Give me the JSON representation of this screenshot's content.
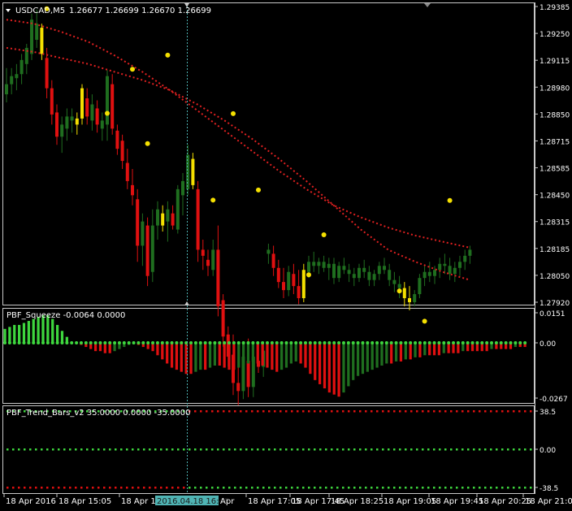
{
  "main_panel": {
    "symbol_title": "USDCAD,M5",
    "ohlc_values": "1.26677 1.26699 1.26670 1.26699",
    "price_axis_labels": [
      "1.29385",
      "1.29250",
      "1.29115",
      "1.28980",
      "1.28850",
      "1.28715",
      "1.28585",
      "1.28450",
      "1.28315",
      "1.28185",
      "1.28050",
      "1.27920"
    ],
    "colors": {
      "bull": "#1f6e1f",
      "bear": "#e01010",
      "squeeze": "#f5e000",
      "ma": "#e02020",
      "dot": "#f5e000"
    }
  },
  "indicator_squeeze": {
    "label": "PBF_Squeeze -0.0064 0.0000",
    "axis_labels": [
      "0.0151",
      "0.00",
      "-0.0267"
    ]
  },
  "indicator_trend_bars": {
    "label": "PBF_Trend_Bars_v2 35.0000 0.0000 -35.0000",
    "axis_labels": [
      "38.5",
      "0.00",
      "-38.5"
    ]
  },
  "time_axis": {
    "labels": [
      "18 Apr 2016",
      "18 Apr 15:05",
      "18 Apr 15:45",
      "18 Apr 17:05",
      "18 Apr 17:45",
      "18 Apr 18:25",
      "18 Apr 19:05",
      "18 Apr 19:45",
      "18 Apr 20:25",
      "18 Apr 21:05"
    ],
    "crosshair_label": "2016.04.18 16:45",
    "partial_label": "Apr"
  },
  "chart_data": {
    "type": "candlestick",
    "title": "USDCAD,M5",
    "ylim": [
      1.2792,
      1.29385
    ],
    "candles": [
      [
        1.2895,
        1.2908,
        1.2891,
        1.29,
        "bull"
      ],
      [
        1.29,
        1.2908,
        1.2895,
        1.2904,
        "bull"
      ],
      [
        1.2903,
        1.291,
        1.2897,
        1.2905,
        "bull"
      ],
      [
        1.2905,
        1.2915,
        1.29,
        1.2912,
        "bull"
      ],
      [
        1.291,
        1.292,
        1.2905,
        1.2918,
        "bull"
      ],
      [
        1.2915,
        1.2935,
        1.2912,
        1.2932,
        "bull"
      ],
      [
        1.293,
        1.2937,
        1.2918,
        1.2922,
        "bull"
      ],
      [
        1.2928,
        1.293,
        1.2912,
        1.2915,
        "squeeze"
      ],
      [
        1.2913,
        1.2918,
        1.2893,
        1.2898,
        "bear"
      ],
      [
        1.2898,
        1.2902,
        1.288,
        1.2885,
        "bear"
      ],
      [
        1.2886,
        1.289,
        1.287,
        1.2874,
        "bear"
      ],
      [
        1.2874,
        1.2884,
        1.2866,
        1.288,
        "bull"
      ],
      [
        1.2878,
        1.2888,
        1.2872,
        1.2884,
        "bull"
      ],
      [
        1.2882,
        1.2888,
        1.2876,
        1.2884,
        "bull"
      ],
      [
        1.288,
        1.2886,
        1.2875,
        1.2883,
        "squeeze"
      ],
      [
        1.2883,
        1.29,
        1.288,
        1.2898,
        "squeeze"
      ],
      [
        1.2893,
        1.2898,
        1.288,
        1.2884,
        "bear"
      ],
      [
        1.2882,
        1.2895,
        1.2877,
        1.289,
        "bull"
      ],
      [
        1.2888,
        1.2892,
        1.2876,
        1.288,
        "bear"
      ],
      [
        1.2878,
        1.2886,
        1.2872,
        1.2882,
        "bull"
      ],
      [
        1.288,
        1.2907,
        1.2872,
        1.2904,
        "bull"
      ],
      [
        1.29,
        1.2905,
        1.2875,
        1.2878,
        "bear"
      ],
      [
        1.2877,
        1.288,
        1.2865,
        1.2868,
        "bear"
      ],
      [
        1.2872,
        1.2875,
        1.2858,
        1.2862,
        "bear"
      ],
      [
        1.2861,
        1.2868,
        1.2848,
        1.2852,
        "bear"
      ],
      [
        1.285,
        1.2858,
        1.284,
        1.2845,
        "bear"
      ],
      [
        1.2843,
        1.2848,
        1.2812,
        1.282,
        "bear"
      ],
      [
        1.282,
        1.2836,
        1.281,
        1.2832,
        "bull"
      ],
      [
        1.283,
        1.2834,
        1.28,
        1.2805,
        "bear"
      ],
      [
        1.2807,
        1.2838,
        1.2802,
        1.283,
        "bull"
      ],
      [
        1.283,
        1.2842,
        1.2823,
        1.2838,
        "bull"
      ],
      [
        1.2836,
        1.284,
        1.2827,
        1.283,
        "squeeze"
      ],
      [
        1.2832,
        1.2842,
        1.2822,
        1.2838,
        "bull"
      ],
      [
        1.2836,
        1.284,
        1.2828,
        1.283,
        "bear"
      ],
      [
        1.2828,
        1.285,
        1.2826,
        1.2848,
        "bull"
      ],
      [
        1.2845,
        1.2856,
        1.2835,
        1.2852,
        "bull"
      ],
      [
        1.2848,
        1.287,
        1.2845,
        1.2865,
        "bull"
      ],
      [
        1.2863,
        1.2866,
        1.2848,
        1.285,
        "squeeze"
      ],
      [
        1.2848,
        1.2852,
        1.2812,
        1.2818,
        "bear"
      ],
      [
        1.2818,
        1.2823,
        1.2808,
        1.2815,
        "bear"
      ],
      [
        1.2813,
        1.2818,
        1.2805,
        1.281,
        "bear"
      ],
      [
        1.2808,
        1.2823,
        1.2805,
        1.2818,
        "bull"
      ],
      [
        1.2818,
        1.283,
        1.2785,
        1.279,
        "bear"
      ],
      [
        1.2793,
        1.2796,
        1.277,
        1.2775,
        "bear"
      ],
      [
        1.2776,
        1.278,
        1.276,
        1.2765,
        "bear"
      ],
      [
        1.2766,
        1.2776,
        1.2746,
        1.2752,
        "bear"
      ],
      [
        1.2752,
        1.2762,
        1.2741,
        1.2748,
        "bear"
      ],
      [
        1.2748,
        1.277,
        1.2744,
        1.2765,
        "bull"
      ],
      [
        1.2763,
        1.2774,
        1.2745,
        1.275,
        "bear"
      ],
      [
        1.275,
        1.277,
        1.2745,
        1.2765,
        "bull"
      ],
      [
        1.2763,
        1.2769,
        1.2757,
        1.276,
        "bear"
      ],
      [
        1.276,
        1.2772,
        1.2755,
        1.2768,
        "bull"
      ]
    ],
    "overlay_candles_note": "",
    "second_segment": [
      [
        1.2818,
        1.2821,
        1.2811,
        1.2816,
        "bull"
      ],
      [
        1.2816,
        1.282,
        1.2805,
        1.2809,
        "bear"
      ],
      [
        1.2809,
        1.2813,
        1.2799,
        1.2802,
        "bear"
      ],
      [
        1.2802,
        1.2809,
        1.2794,
        1.2798,
        "bear"
      ],
      [
        1.2798,
        1.281,
        1.2795,
        1.2807,
        "bull"
      ],
      [
        1.2806,
        1.2811,
        1.2796,
        1.28,
        "bear"
      ],
      [
        1.28,
        1.2808,
        1.2791,
        1.2794,
        "bear"
      ],
      [
        1.2794,
        1.2811,
        1.2792,
        1.2808,
        "squeeze"
      ],
      [
        1.2807,
        1.2815,
        1.2804,
        1.2812,
        "bull"
      ],
      [
        1.2812,
        1.2817,
        1.2807,
        1.281,
        "bull"
      ],
      [
        1.281,
        1.2814,
        1.2806,
        1.2812,
        "bull"
      ],
      [
        1.2812,
        1.2815,
        1.2807,
        1.2809,
        "bull"
      ],
      [
        1.2809,
        1.2814,
        1.2803,
        1.2811,
        "bull"
      ],
      [
        1.2811,
        1.2814,
        1.2801,
        1.2804,
        "bull"
      ],
      [
        1.2804,
        1.2812,
        1.2802,
        1.281,
        "bull"
      ],
      [
        1.281,
        1.2814,
        1.2806,
        1.2808,
        "bull"
      ],
      [
        1.2808,
        1.2811,
        1.2802,
        1.2806,
        "bull"
      ],
      [
        1.2806,
        1.2809,
        1.28,
        1.2804,
        "bull"
      ],
      [
        1.2804,
        1.2811,
        1.2802,
        1.2809,
        "bull"
      ],
      [
        1.2809,
        1.2813,
        1.2804,
        1.2807,
        "bull"
      ],
      [
        1.2807,
        1.281,
        1.28,
        1.2803,
        "bull"
      ],
      [
        1.2803,
        1.2808,
        1.28,
        1.2806,
        "bull"
      ],
      [
        1.2806,
        1.2812,
        1.2803,
        1.281,
        "bull"
      ],
      [
        1.281,
        1.2814,
        1.2806,
        1.2808,
        "bull"
      ],
      [
        1.2808,
        1.2811,
        1.28,
        1.2803,
        "bull"
      ],
      [
        1.2803,
        1.2807,
        1.2797,
        1.2801,
        "bull"
      ],
      [
        1.2801,
        1.2805,
        1.2794,
        1.2799,
        "bull"
      ],
      [
        1.2799,
        1.2802,
        1.279,
        1.2794,
        "squeeze"
      ],
      [
        1.2794,
        1.28,
        1.2788,
        1.2792,
        "squeeze"
      ],
      [
        1.2792,
        1.2798,
        1.279,
        1.2796,
        "bull"
      ],
      [
        1.2796,
        1.2806,
        1.2794,
        1.2804,
        "bull"
      ],
      [
        1.2804,
        1.281,
        1.28,
        1.2807,
        "bull"
      ],
      [
        1.2807,
        1.2812,
        1.2802,
        1.2805,
        "bull"
      ],
      [
        1.2805,
        1.281,
        1.2801,
        1.2808,
        "bull"
      ],
      [
        1.2808,
        1.2814,
        1.2804,
        1.2811,
        "bull"
      ],
      [
        1.2811,
        1.2816,
        1.2806,
        1.281,
        "bull"
      ],
      [
        1.281,
        1.2814,
        1.2803,
        1.2806,
        "bull"
      ],
      [
        1.2806,
        1.2812,
        1.2802,
        1.2809,
        "bull"
      ],
      [
        1.2809,
        1.2815,
        1.2805,
        1.2812,
        "bull"
      ],
      [
        1.2812,
        1.2818,
        1.2808,
        1.2815,
        "bull"
      ],
      [
        1.2815,
        1.282,
        1.2811,
        1.2818,
        "bull"
      ]
    ],
    "ma_fast": [
      1.2918,
      1.2916,
      1.2913,
      1.291,
      1.2906,
      1.2902,
      1.2897,
      1.289,
      1.2882,
      1.2873,
      1.2863,
      1.2852,
      1.284,
      1.2828,
      1.2818,
      1.2812,
      1.2807,
      1.2803
    ],
    "ma_slow": [
      1.2932,
      1.293,
      1.2926,
      1.2921,
      1.2914,
      1.2906,
      1.2897,
      1.2887,
      1.2877,
      1.2867,
      1.2857,
      1.2848,
      1.284,
      1.2834,
      1.2829,
      1.2825,
      1.2822,
      1.2819
    ],
    "squeeze_histogram": [
      0.007,
      0.008,
      0.009,
      0.009,
      0.01,
      0.011,
      0.012,
      0.013,
      0.014,
      0.014,
      0.012,
      0.009,
      0.006,
      0.003,
      0.0,
      0.0,
      -0.001,
      -0.002,
      -0.003,
      -0.004,
      -0.004,
      -0.005,
      -0.005,
      -0.004,
      -0.003,
      -0.002,
      -0.001,
      0.0,
      -0.001,
      -0.002,
      -0.003,
      -0.004,
      -0.006,
      -0.008,
      -0.01,
      -0.012,
      -0.013,
      -0.014,
      -0.015,
      -0.015,
      -0.014,
      -0.013,
      -0.013,
      -0.012,
      -0.011,
      -0.011,
      -0.012,
      -0.013,
      -0.013,
      -0.012,
      -0.011,
      -0.01,
      -0.009,
      -0.01,
      -0.011,
      -0.012,
      -0.013,
      -0.014,
      -0.013,
      -0.012,
      -0.01,
      -0.009,
      -0.01,
      -0.012,
      -0.015,
      -0.018,
      -0.02,
      -0.022,
      -0.024,
      -0.025,
      -0.026,
      -0.024,
      -0.021,
      -0.018,
      -0.016,
      -0.015,
      -0.014,
      -0.013,
      -0.012,
      -0.011,
      -0.01,
      -0.01,
      -0.009,
      -0.009,
      -0.008,
      -0.008,
      -0.007,
      -0.007,
      -0.006,
      -0.006,
      -0.006,
      -0.006,
      -0.005,
      -0.005,
      -0.005,
      -0.005,
      -0.004,
      -0.004,
      -0.004,
      -0.004,
      -0.004,
      -0.004,
      -0.003,
      -0.003,
      -0.003,
      -0.003,
      -0.003,
      -0.002,
      -0.002,
      -0.002
    ],
    "trend_bars": {
      "levels": [
        35,
        0,
        -35
      ]
    }
  }
}
